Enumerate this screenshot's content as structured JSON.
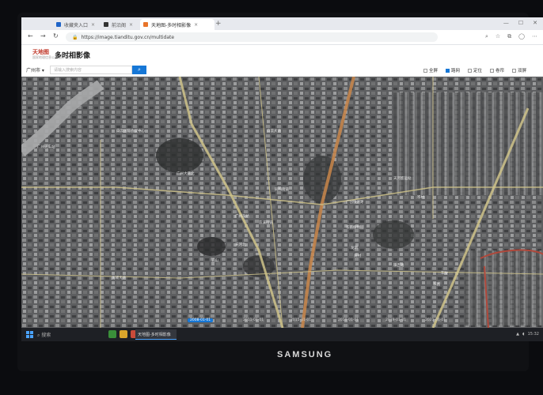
{
  "browser": {
    "tabs": [
      {
        "label": "收藏夹入口",
        "active": false
      },
      {
        "label": "前沿阁",
        "active": false
      },
      {
        "label": "天地图-多时相影像",
        "active": true
      }
    ],
    "new_tab": "+",
    "url": "https://image.tianditu.gov.cn/multidate"
  },
  "app": {
    "logo_line1": "天地图",
    "logo_line2": "国家地理信息公共服务平台",
    "title": "多时相影像"
  },
  "toolbar": {
    "city": "广州市 ▾",
    "search_placeholder": "请输入搜索内容",
    "search_icon": "search-icon",
    "options": [
      {
        "label": "全屏",
        "checked": false
      },
      {
        "label": "路网",
        "checked": true
      },
      {
        "label": "定位",
        "checked": false
      },
      {
        "label": "卷帘",
        "checked": false
      },
      {
        "label": "双屏",
        "checked": false
      }
    ]
  },
  "map": {
    "labels": [
      "广州火车站",
      "白云国际会议中心",
      "广州大道北",
      "白云大道",
      "同和街道",
      "京溪街道",
      "广园快速路",
      "天河客运站",
      "岑村",
      "龙洞",
      "华南植物园",
      "黄村",
      "广州东站",
      "天河北",
      "五山",
      "珠吉路",
      "车陂",
      "东圃",
      "黄埔大道"
    ],
    "timeline": [
      {
        "label": "2008-01-01",
        "active": true
      },
      {
        "label": "2011-01-01",
        "active": false
      },
      {
        "label": "2015-01-01",
        "active": false
      },
      {
        "label": "2018-01-01",
        "active": false
      },
      {
        "label": "2019-01-01",
        "active": false
      },
      {
        "label": "2021-01-01",
        "active": false
      }
    ]
  },
  "taskbar": {
    "search_label": "搜索",
    "active_window": "天地图-多时相影像",
    "clock": "15:32"
  },
  "monitor": {
    "brand": "SAMSUNG"
  }
}
